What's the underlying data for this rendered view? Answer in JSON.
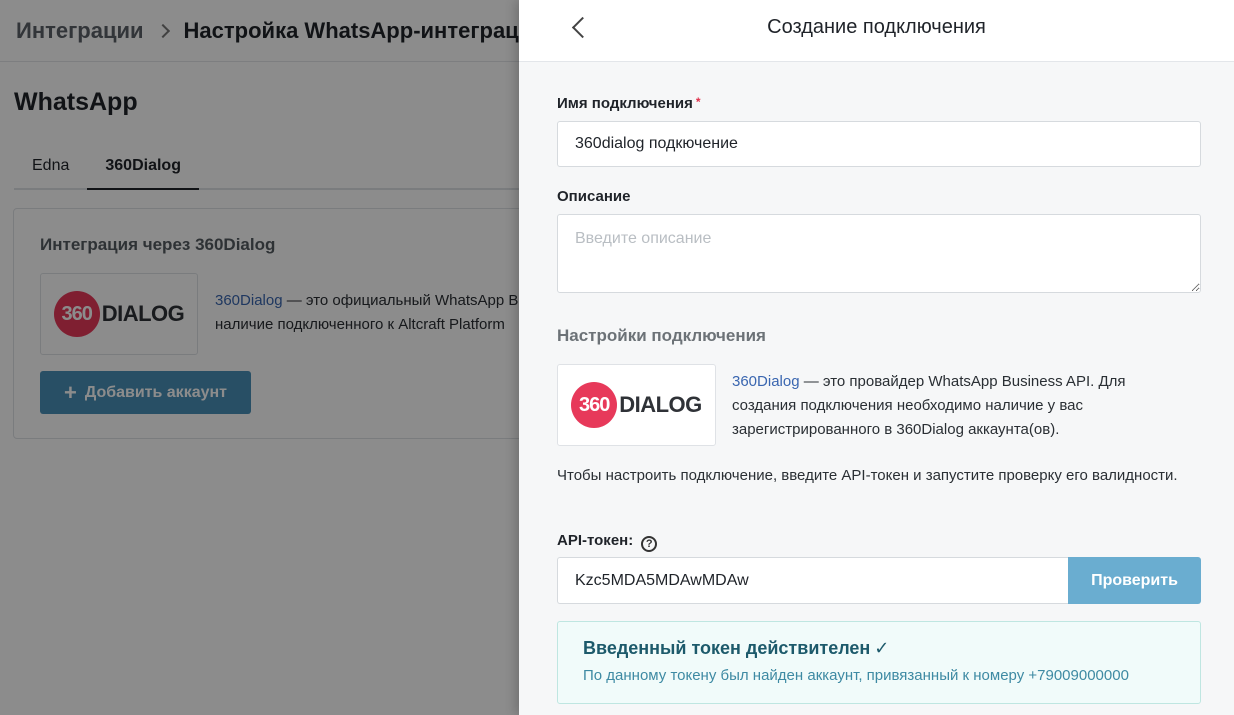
{
  "breadcrumb": {
    "root": "Интеграции",
    "current": "Настройка WhatsApp-интеграц"
  },
  "page": {
    "title": "WhatsApp",
    "tabs": [
      {
        "label": "Edna"
      },
      {
        "label": "360Dialog"
      }
    ],
    "card": {
      "title": "Интеграция через 360Dialog",
      "link": "360Dialog",
      "line1_rest": " — это официальный WhatsApp B",
      "line2": "наличие подключенного к Altcraft Platform",
      "add_button": "Добавить аккаунт"
    }
  },
  "logo": {
    "number": "360",
    "word": "DIALOG"
  },
  "drawer": {
    "title": "Создание подключения",
    "name_label": "Имя подключения",
    "required_mark": "*",
    "name_value": "360dialog подкючение",
    "description_label": "Описание",
    "description_placeholder": "Введите описание",
    "settings_title": "Настройки подключения",
    "info_link": "360Dialog",
    "info_text": " — это провайдер WhatsApp Business API. Для создания подключения необходимо наличие у вас зарегистрированного в 360Dialog аккаунта(ов).",
    "hint": "Чтобы настроить подключение, введите API-токен и запустите проверку его валидности.",
    "token_label": "API-токен:",
    "token_value": "Kzc5MDA5MDAwMDAw",
    "verify_button": "Проверить",
    "success_title": "Введенный токен действителен",
    "success_check": "✓",
    "success_text": "По данному токену был найден аккаунт, привязанный к номеру +79009000000"
  },
  "colors": {
    "accent": "#6aadd0",
    "brand_logo": "#e7395a",
    "success_bg": "#f1fbfa"
  }
}
